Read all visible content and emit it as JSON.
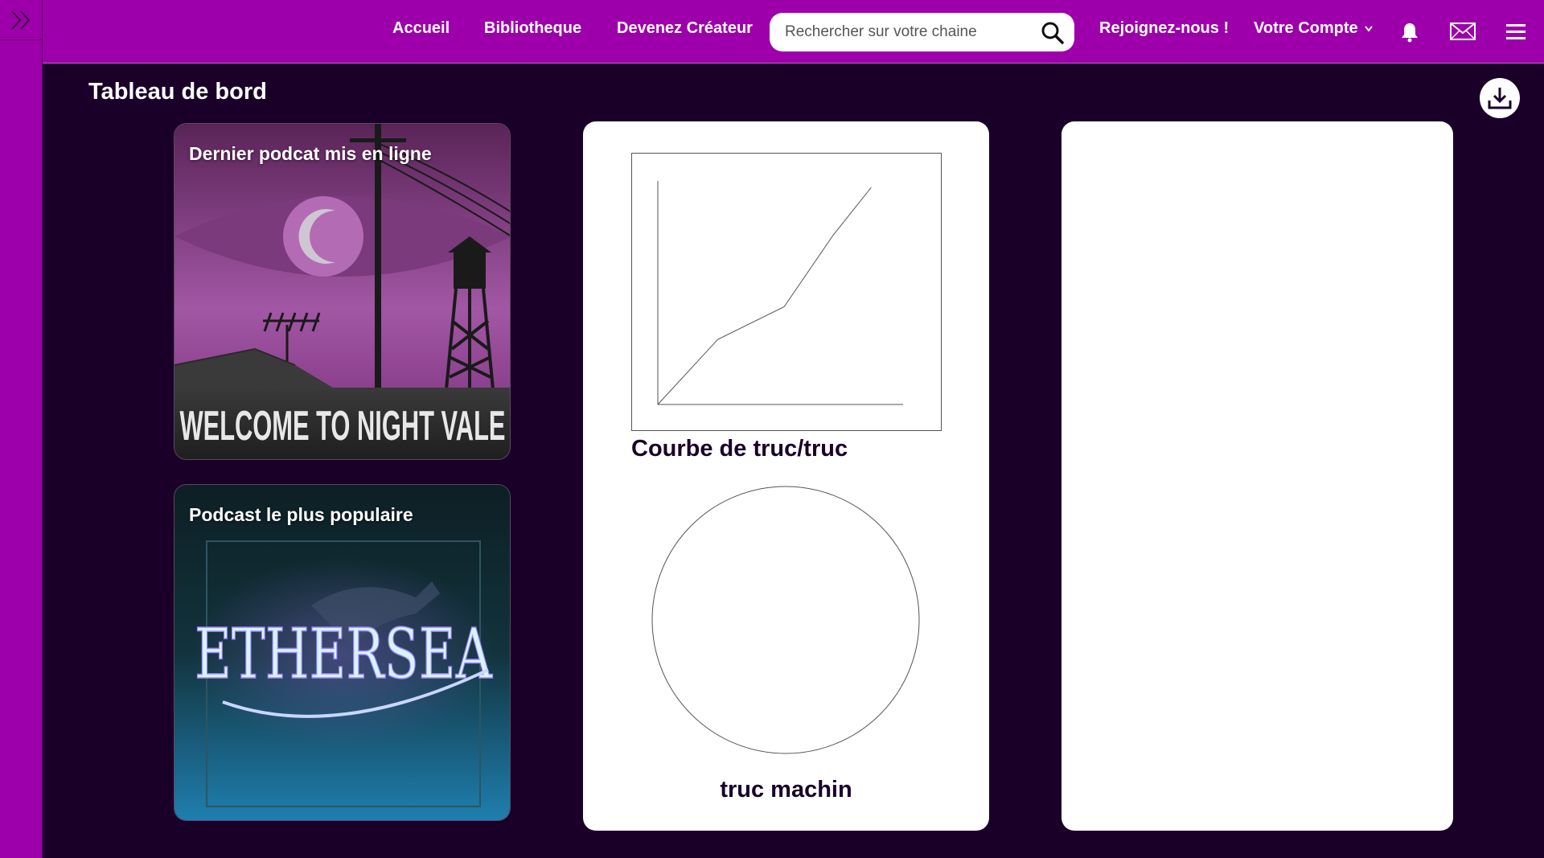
{
  "nav": {
    "home": "Accueil",
    "library": "Bibliotheque",
    "become_creator": "Devenez Créateur",
    "join": "Rejoignez-nous !",
    "account": "Votre Compte"
  },
  "search": {
    "placeholder": "Rechercher sur votre chaine",
    "value": ""
  },
  "page": {
    "title": "Tableau de bord"
  },
  "cards": {
    "latest": {
      "label": "Dernier podcat mis en ligne",
      "artwork_text": "WELCOME TO NIGHT VALE"
    },
    "popular": {
      "label": "Podcast le plus populaire",
      "artwork_text": "ETHERSEA"
    }
  },
  "charts": {
    "line_caption": "Courbe de truc/truc",
    "pie_caption": "truc machin"
  },
  "chart_data": [
    {
      "type": "line",
      "title": "",
      "xlabel": "",
      "ylabel": "",
      "x": [
        0,
        1,
        2,
        3,
        4
      ],
      "series": [
        {
          "values": [
            0,
            30,
            45,
            78,
            100
          ]
        }
      ]
    },
    {
      "type": "pie",
      "title": "",
      "values": []
    }
  ],
  "colors": {
    "brand": "#9d00aa",
    "background": "#1a0029",
    "panel": "#ffffff"
  },
  "icons": {
    "sidebar_toggle": "double-chevron-right-icon",
    "search": "search-icon",
    "account_caret": "chevron-down-icon",
    "notifications": "bell-icon",
    "messages": "mail-icon",
    "menu": "hamburger-menu-icon",
    "download": "download-icon"
  }
}
